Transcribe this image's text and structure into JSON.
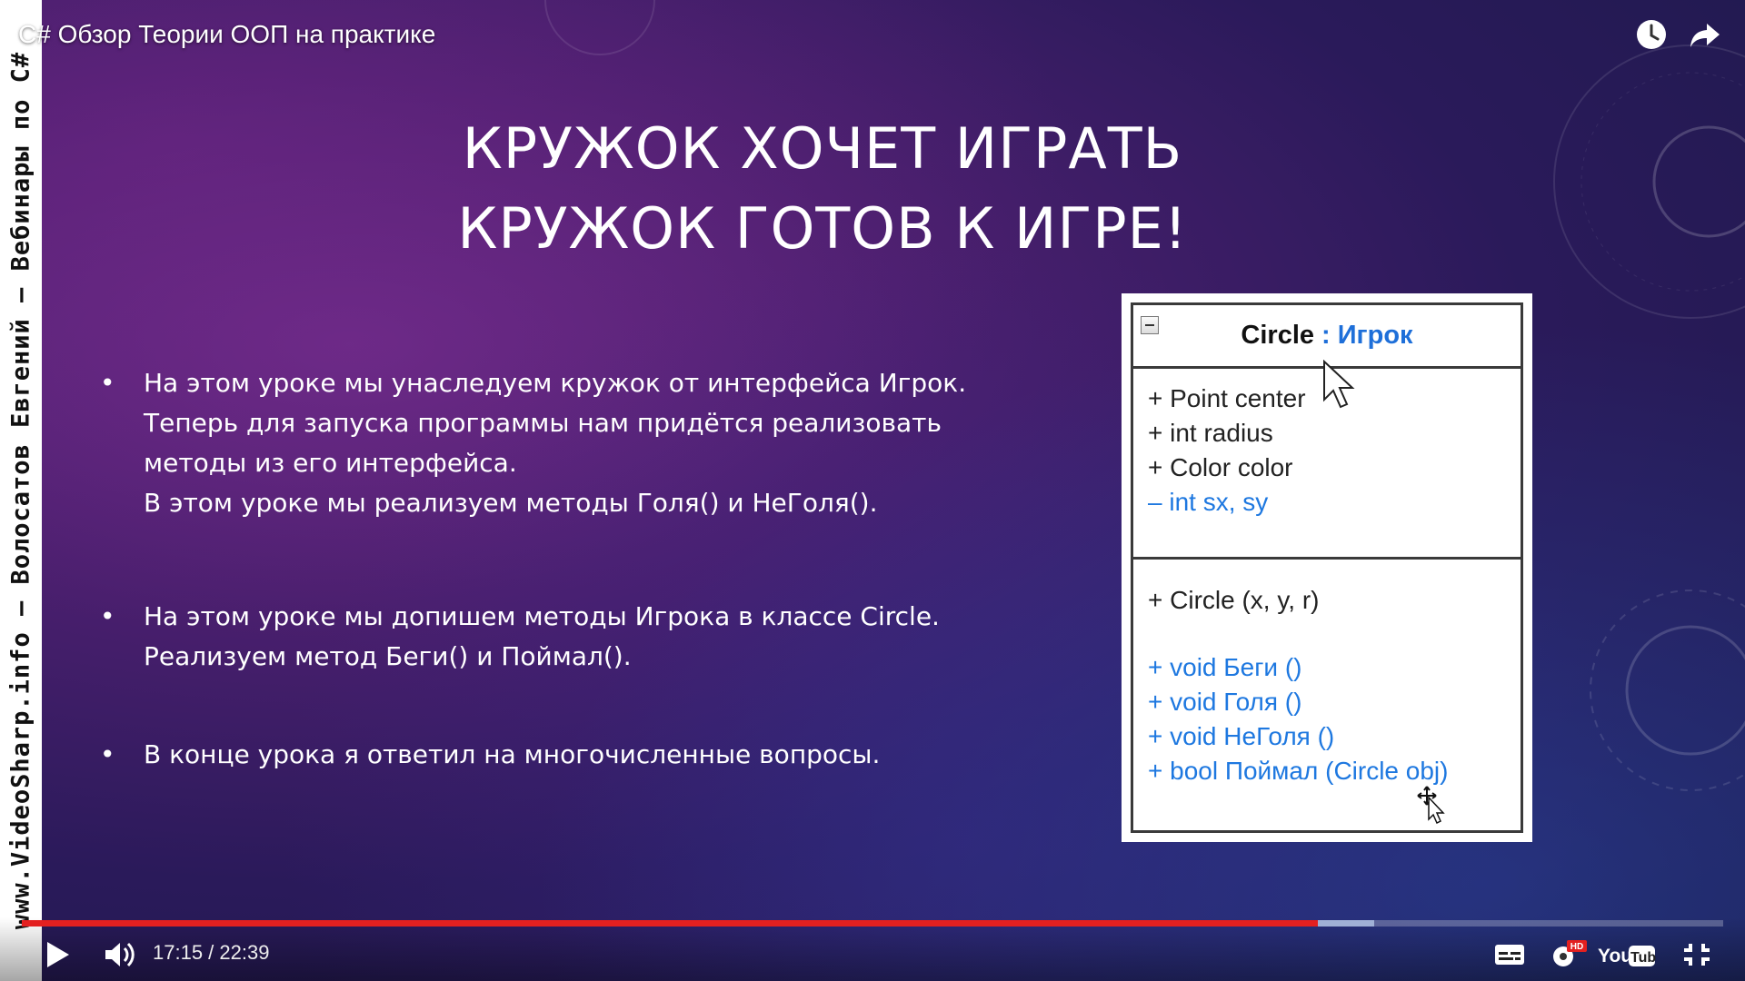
{
  "video": {
    "title": "C# Обзор Теории ООП на практике",
    "current_time": "17:15",
    "duration": "22:39",
    "time_display": "17:15 / 22:39",
    "progress_fraction": 0.762,
    "buffered_fraction": 0.795
  },
  "watermark": {
    "vertical_text": "www.VideoSharp.info – Волосатов Евгений – Вебинары по C#"
  },
  "slide": {
    "title_line1": "КРУЖОК ХОЧЕТ ИГРАТЬ",
    "title_line2": "КРУЖОК ГОТОВ К ИГРЕ!",
    "bullets": [
      {
        "lines": [
          "На этом уроке мы унаследуем кружок от интерфейса Игрок.",
          "Теперь для запуска программы нам придётся реализовать",
          "методы из его интерфейса.",
          "В этом уроке мы реализуем методы Голя() и НеГоля()."
        ]
      },
      {
        "lines": [
          "На этом уроке мы допишем методы Игрока в классе Circle.",
          "Реализуем метод Беги() и Поймал()."
        ]
      },
      {
        "lines": [
          "В конце урока я ответил на многочисленные вопросы."
        ]
      }
    ]
  },
  "uml": {
    "class_name": "Circle",
    "separator": ":",
    "interface_name": "Игрок",
    "fields": [
      {
        "text": "+ Point center",
        "blue": false
      },
      {
        "text": "+ int radius",
        "blue": false
      },
      {
        "text": "+ Color color",
        "blue": false
      },
      {
        "text": "– int sx, sy",
        "blue": true
      }
    ],
    "constructor": "+ Circle (x, y, r)",
    "methods": [
      {
        "text": "+ void Беги ()",
        "blue": true
      },
      {
        "text": "+ void Голя ()",
        "blue": true
      },
      {
        "text": "+ void НеГоля ()",
        "blue": true
      },
      {
        "text": "+ bool Поймал (Circle obj)",
        "blue": true
      }
    ]
  },
  "icons": {
    "watch_later": "clock-icon",
    "share": "share-icon",
    "play": "play-icon",
    "volume": "volume-icon",
    "subtitles": "subtitles-icon",
    "settings": "settings-hd-icon",
    "youtube": "youtube-logo",
    "exit_fullscreen": "exit-fullscreen-icon"
  },
  "player_labels": {
    "settings_badge": "HD",
    "youtube_you": "You",
    "youtube_tube": "Tube"
  },
  "colors": {
    "progress_played": "#e32020",
    "uml_blue": "#1e78e0",
    "background": "#4a1f6e"
  }
}
